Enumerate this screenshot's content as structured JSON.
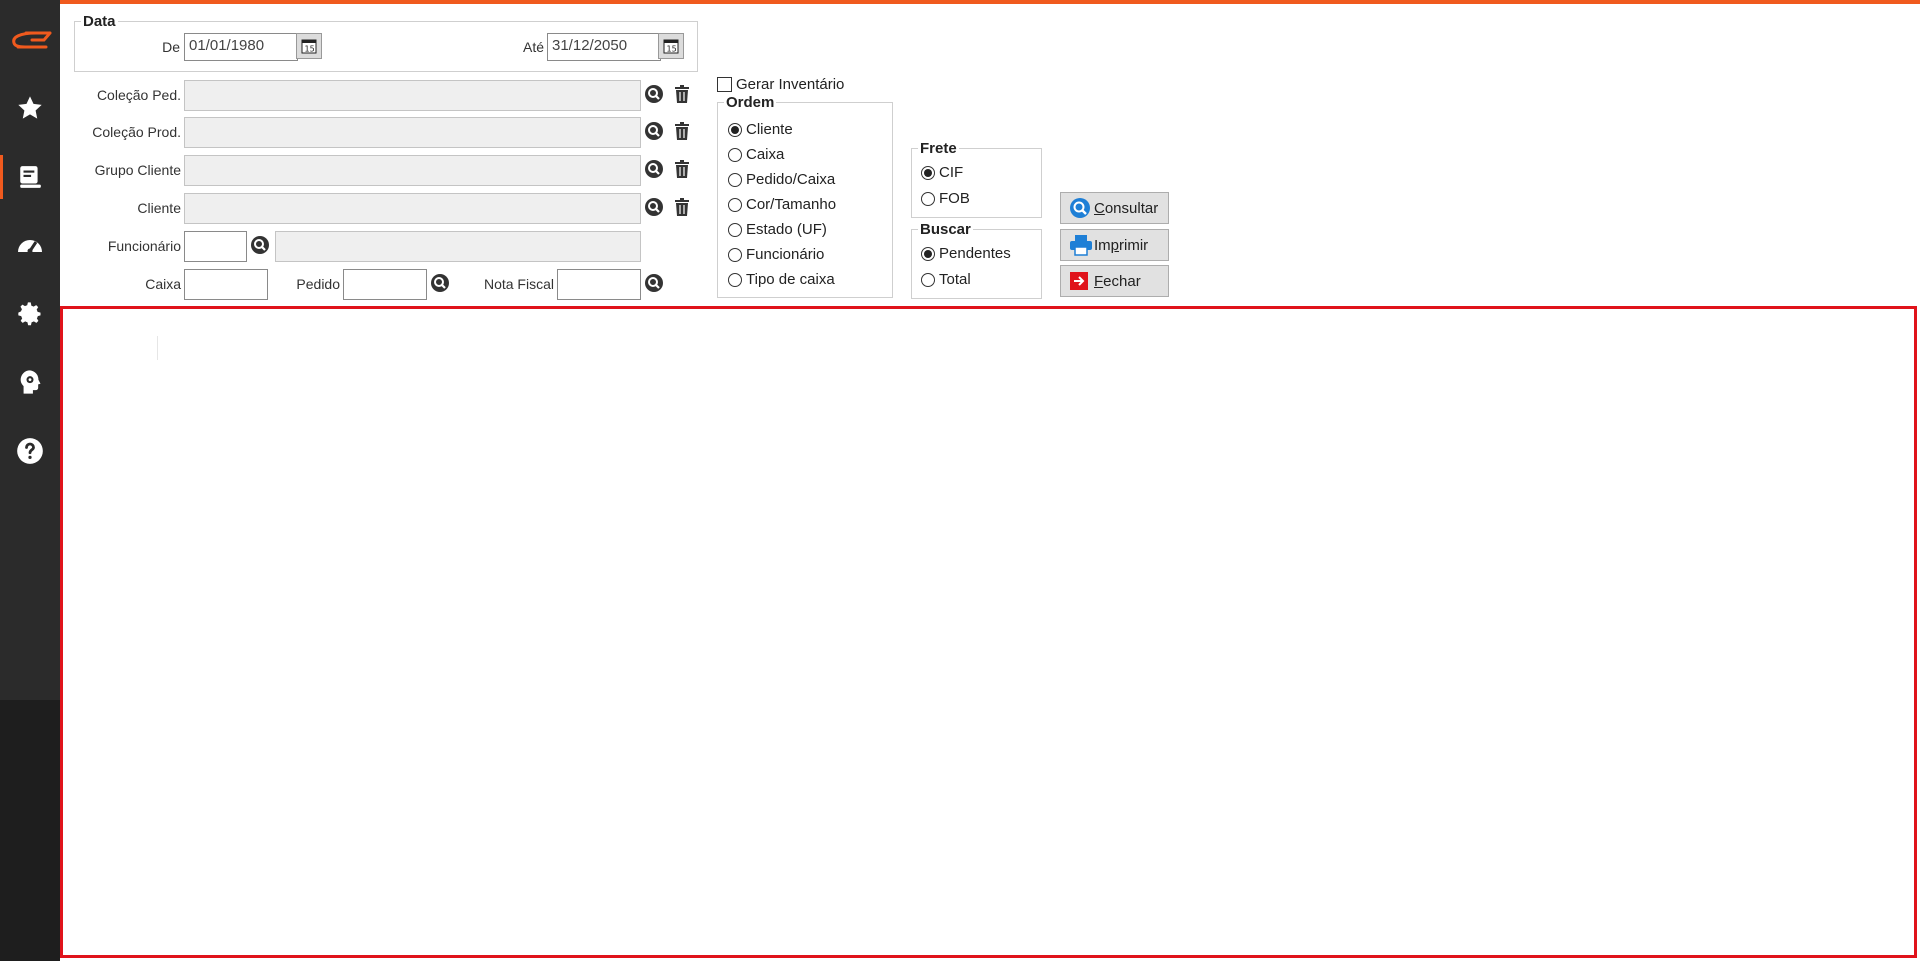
{
  "sidebar": {
    "logo": "ce-logo",
    "items": [
      {
        "icon": "star-icon"
      },
      {
        "icon": "report-icon",
        "active": true
      },
      {
        "icon": "dashboard-icon"
      },
      {
        "icon": "gear-icon"
      },
      {
        "icon": "brain-gear-icon"
      },
      {
        "icon": "help-icon"
      }
    ]
  },
  "colors": {
    "accent": "#f05a1e",
    "grid_border": "#e0131b",
    "sidebar": "#2b2b2b"
  },
  "data_group": {
    "title": "Data",
    "from_label": "De",
    "from_value": "01/01/1980",
    "to_label": "Até",
    "to_value": "31/12/2050"
  },
  "filters": {
    "colecao_ped": "Coleção Ped.",
    "colecao_prod": "Coleção Prod.",
    "grupo_cliente": "Grupo Cliente",
    "cliente": "Cliente",
    "funcionario": "Funcionário",
    "caixa": "Caixa",
    "pedido": "Pedido",
    "nota_fiscal": "Nota Fiscal"
  },
  "gerar_inventario": {
    "label": "Gerar Inventário",
    "checked": false
  },
  "ordem": {
    "title": "Ordem",
    "options": [
      "Cliente",
      "Caixa",
      "Pedido/Caixa",
      "Cor/Tamanho",
      "Estado (UF)",
      "Funcionário",
      "Tipo de caixa"
    ],
    "selected": "Cliente"
  },
  "frete": {
    "title": "Frete",
    "options": [
      "CIF",
      "FOB"
    ],
    "selected": "CIF"
  },
  "buscar": {
    "title": "Buscar",
    "options": [
      "Pendentes",
      "Total"
    ],
    "selected": "Pendentes"
  },
  "buttons": {
    "consultar": {
      "hotkey": "C",
      "rest": "onsultar"
    },
    "imprimir": {
      "pre": "Im",
      "hotkey": "p",
      "rest": "rimir"
    },
    "fechar": {
      "hotkey": "F",
      "rest": "echar"
    }
  }
}
